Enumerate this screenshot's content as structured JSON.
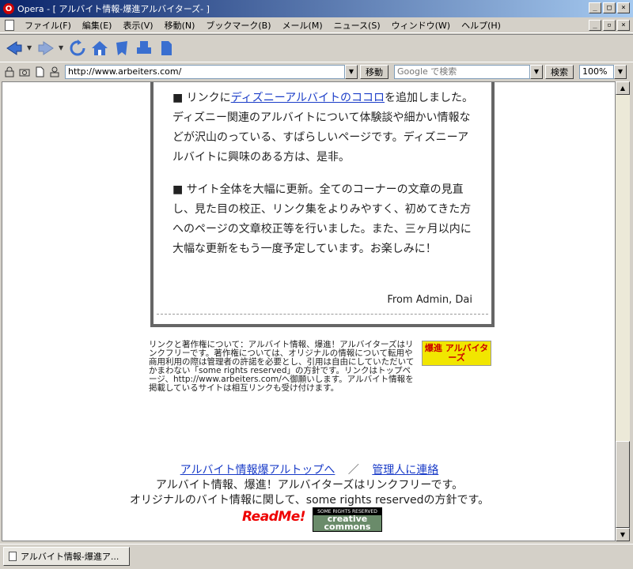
{
  "window": {
    "title": "Opera - [ アルバイト情報-爆進アルバイターズ- ]",
    "app_icon": "O"
  },
  "menu": {
    "items": [
      "ファイル(F)",
      "編集(E)",
      "表示(V)",
      "移動(N)",
      "ブックマーク(B)",
      "メール(M)",
      "ニュース(S)",
      "ウィンドウ(W)",
      "ヘルプ(H)"
    ]
  },
  "toolbar": {
    "icons": [
      "back-arrow-icon",
      "forward-arrow-icon",
      "reload-icon",
      "home-icon",
      "bookmarks-icon",
      "print-icon",
      "page-icon"
    ]
  },
  "address": {
    "url": "http://www.arbeiters.com/",
    "go_label": "移動",
    "search_placeholder": "Google で検索",
    "search_label": "検索",
    "zoom": "100%"
  },
  "article": {
    "p1_prefix": "■ リンクに",
    "p1_link": "ディズニーアルバイトのココロ",
    "p1_suffix": "を追加しました。ディズニー関連のアルバイトについて体験談や細かい情報などが沢山のっている、すばらしいページです。ディズニーアルバイトに興味のある方は、是非。",
    "p2": "■ サイト全体を大幅に更新。全てのコーナーの文章の見直し、見た目の校正、リンク集をよりみやすく、初めてきた方へのページの文章校正等を行いました。また、三ヶ月以内に大幅な更新をもう一度予定しています。お楽しみに！",
    "signature": "From Admin, Dai"
  },
  "license": {
    "text": "リンクと著作権について：アルバイト情報、爆進！アルバイターズはリンクフリーです。著作権については、オリジナルの情報について転用や商用利用の際は管理者の許諾を必要とし、引用は自由にしていただいてかまわない「some rights reserved」の方針です。リンクはトップページ、http://www.arbeiters.com/へ御願いします。アルバイト情報を掲載しているサイトは相互リンクも受け付けます。",
    "badge": "爆進 アルバイターズ"
  },
  "footer": {
    "link_top": "アルバイト情報爆アルトップへ",
    "separator": "／",
    "link_contact": "管理人に連絡",
    "line1": "アルバイト情報、爆進！アルバイターズはリンクフリーです。",
    "line2": "オリジナルのバイト情報に関して、some rights reservedの方針です。",
    "readme_badge": "ReadMe!",
    "cc_top": "SOME RIGHTS RESERVED",
    "cc_bottom": "creative commons"
  },
  "tabs": [
    {
      "label": "アルバイト情報-爆進ア..."
    }
  ]
}
